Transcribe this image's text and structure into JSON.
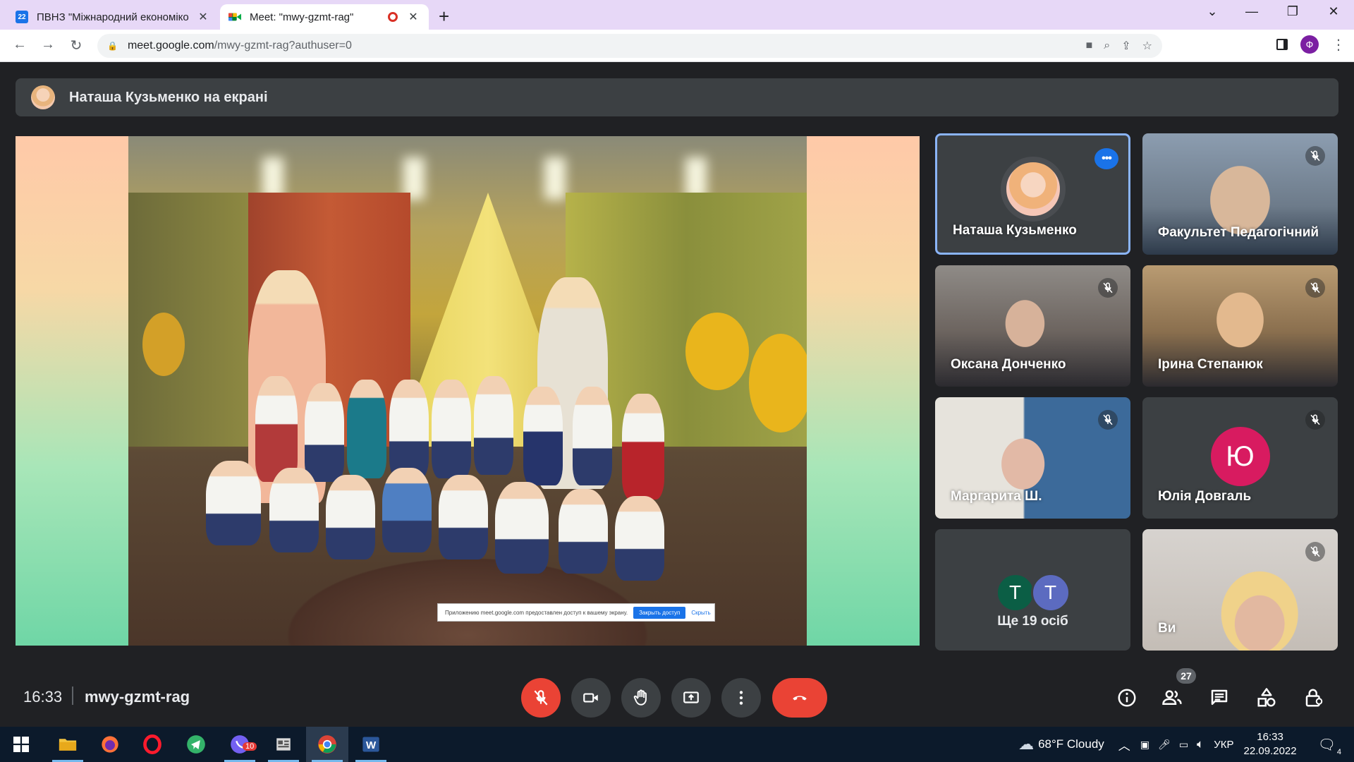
{
  "browser": {
    "tabs": [
      {
        "title": "ПВНЗ \"Міжнародний економіко",
        "favicon": "calendar-icon",
        "active": false
      },
      {
        "title": "Meet: \"mwy-gzmt-rag\"",
        "favicon": "google-meet-icon",
        "active": true,
        "recording": true
      }
    ],
    "url_host": "meet.google.com",
    "url_path": "/mwy-gzmt-rag?authuser=0",
    "profile_initial": "Ф"
  },
  "meet": {
    "presenting_banner": "Наташа Кузьменко на екрані",
    "share_notice": {
      "text": "Приложению meet.google.com предоставлен доступ к вашему экрану.",
      "stop_label": "Закрыть доступ",
      "hide_label": "Скрыть"
    },
    "participants": [
      {
        "name": "Наташа Кузьменко",
        "type": "avatar",
        "speaking": true
      },
      {
        "name": "Факультет Педагогічний",
        "type": "video",
        "muted": true
      },
      {
        "name": "Оксана Донченко",
        "type": "video",
        "muted": true
      },
      {
        "name": "Ірина Степанюк",
        "type": "video",
        "muted": true
      },
      {
        "name": "Маргарита Ш.",
        "type": "video",
        "muted": true
      },
      {
        "name": "Юлія Довгаль",
        "type": "letter",
        "letter": "Ю",
        "color": "#d81b60",
        "muted": true
      },
      {
        "name": "Ще 19 осіб",
        "type": "more",
        "letters": [
          "Т",
          "Т"
        ],
        "colors": [
          "#0b5e45",
          "#5c6bc0"
        ]
      },
      {
        "name": "Ви",
        "type": "video",
        "muted": true
      }
    ],
    "time": "16:33",
    "meeting_code": "mwy-gzmt-rag",
    "people_count": "27",
    "accent_red": "#ea4335"
  },
  "taskbar": {
    "weather": "68°F  Cloudy",
    "lang": "УКР",
    "time": "16:33",
    "date": "22.09.2022",
    "viber_badge": "10",
    "notifications": "4"
  }
}
